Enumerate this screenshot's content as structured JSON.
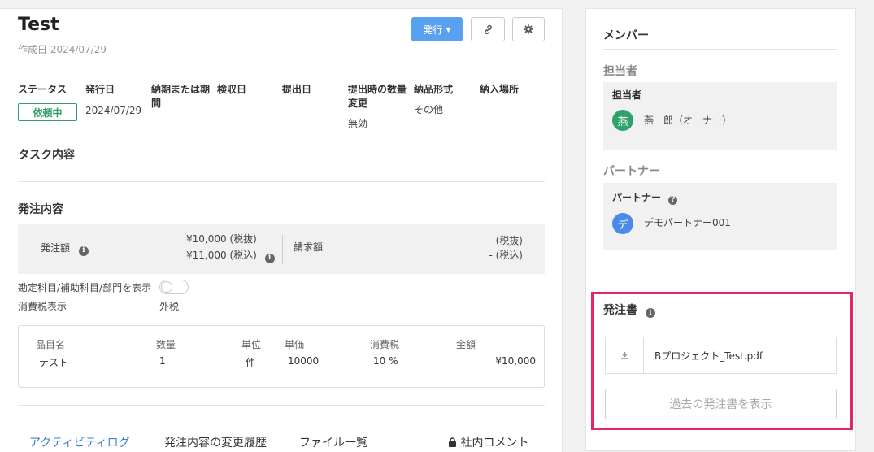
{
  "header": {
    "title": "Test",
    "created": "作成日 2024/07/29",
    "publish_label": "発行",
    "link_icon": "link-icon",
    "settings_icon": "gear-icon"
  },
  "fields": {
    "status": {
      "label": "ステータス",
      "value": "依頼中"
    },
    "issue_date": {
      "label": "発行日",
      "value": "2024/07/29"
    },
    "deadline": {
      "label": "納期または期間"
    },
    "inspection_date": {
      "label": "検収日"
    },
    "submit_date": {
      "label": "提出日"
    },
    "qty_change": {
      "label": "提出時の数量変更",
      "value": "無効"
    },
    "delivery_format": {
      "label": "納品形式",
      "value": "その他"
    },
    "delivery_place": {
      "label": "納入場所"
    }
  },
  "task": {
    "title": "タスク内容"
  },
  "order": {
    "title": "発注内容",
    "amount_label": "発注額",
    "amount_excl": "¥10,000 (税抜)",
    "amount_incl": "¥11,000 (税込)",
    "invoice_label": "請求額",
    "invoice_excl": "- (税抜)",
    "invoice_incl": "- (税込)",
    "accounts_toggle_label": "勘定科目/補助科目/部門を表示",
    "tax_display_label": "消費税表示",
    "tax_display_value": "外税"
  },
  "items": {
    "headers": {
      "name": "品目名",
      "qty": "数量",
      "unit": "単位",
      "price": "単価",
      "tax": "消費税",
      "amount": "金額"
    },
    "rows": [
      {
        "name": "テスト",
        "qty": "1",
        "unit": "件",
        "price": "10000",
        "tax": "10 %",
        "amount": "¥10,000"
      }
    ]
  },
  "tabs": [
    {
      "label": "アクティビティログ",
      "active": true
    },
    {
      "label": "発注内容の変更履歴"
    },
    {
      "label": "ファイル一覧"
    },
    {
      "label": "社内コメント"
    }
  ],
  "members": {
    "title": "メンバー",
    "owner_section": "担当者",
    "owner_box_label": "担当者",
    "owner_avatar": "燕",
    "owner_name": "燕一郎（オーナー）",
    "partner_section": "パートナー",
    "partner_box_label": "パートナー",
    "partner_avatar": "デ",
    "partner_name": "デモパートナー001"
  },
  "po": {
    "title": "発注書",
    "file_name": "Bプロジェクト_Test.pdf",
    "past_button": "過去の発注書を表示"
  },
  "colors": {
    "accent": "#5aa0f0",
    "status": "#2ea26a",
    "owner_avatar": "#2ea26a",
    "partner_avatar": "#4a8ae8",
    "highlight": "#e8246a"
  }
}
